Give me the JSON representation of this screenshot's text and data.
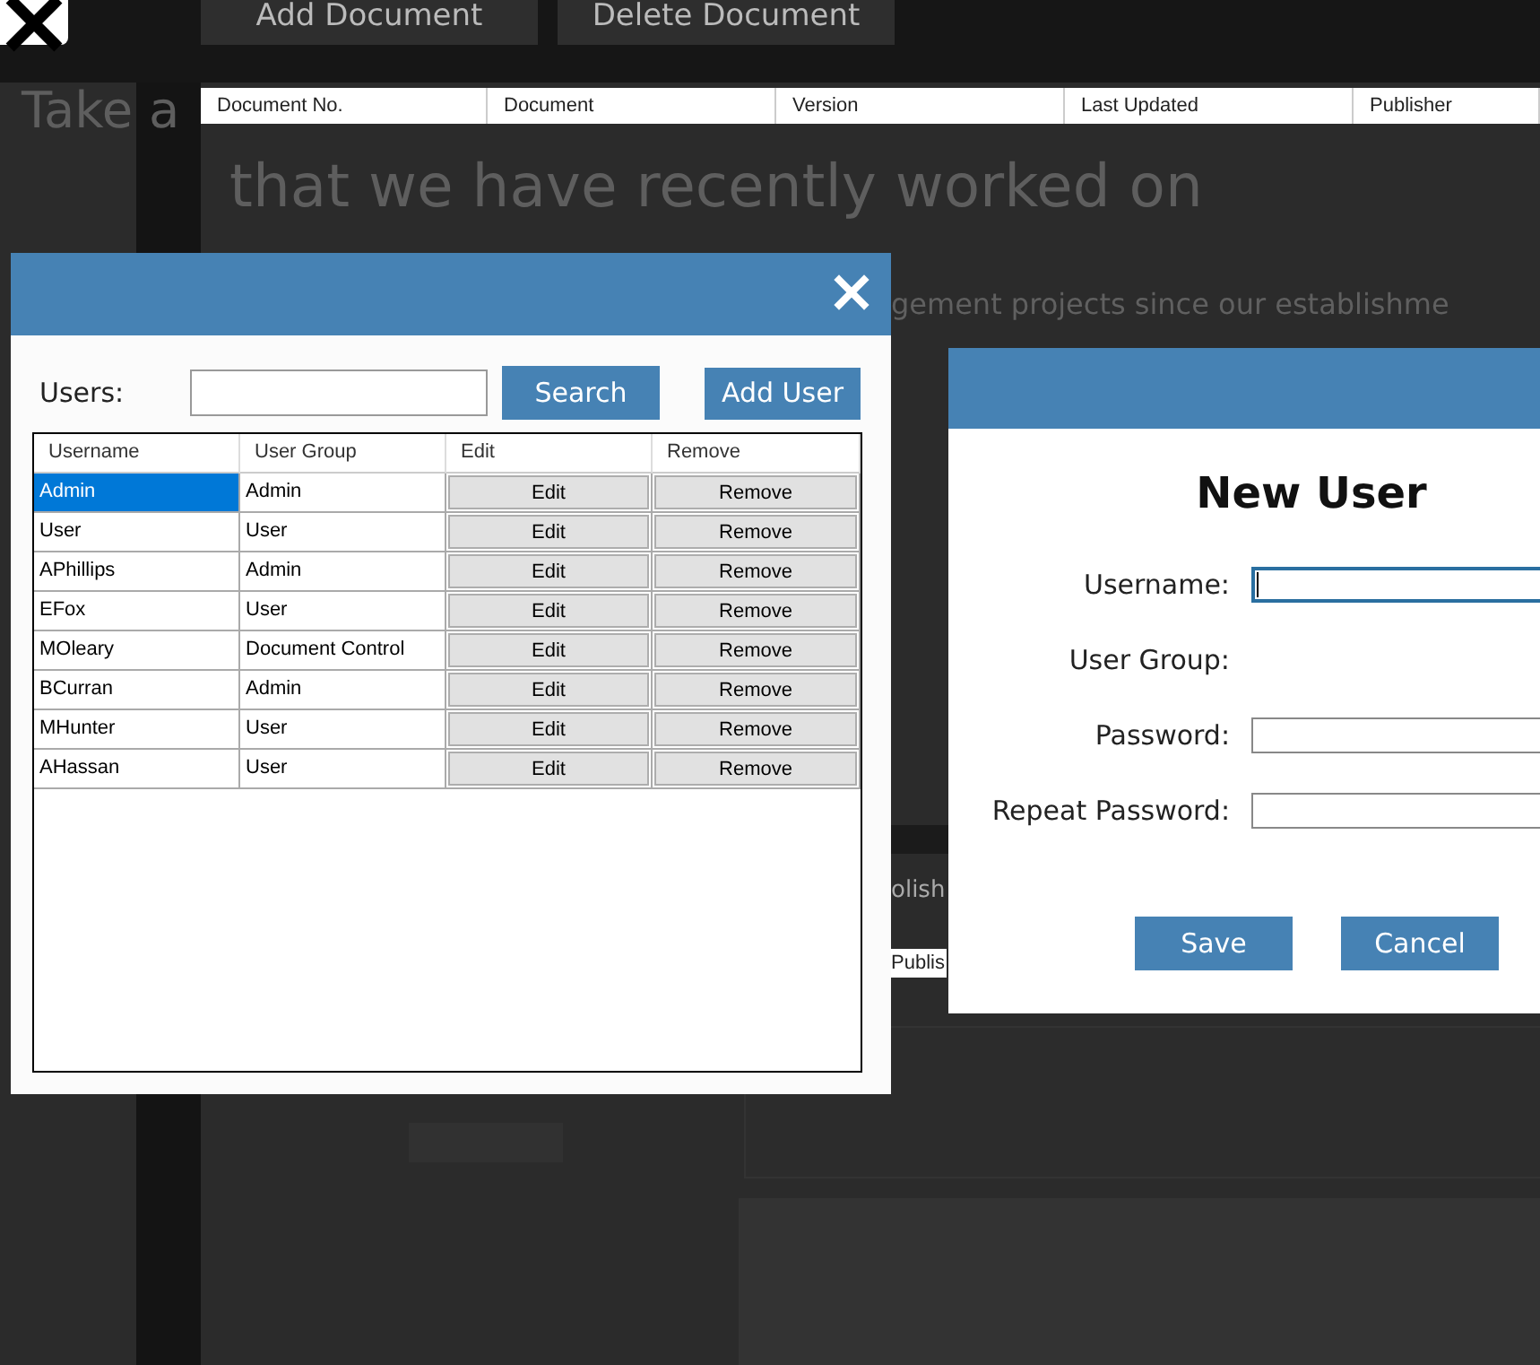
{
  "toolbar": {
    "buttons": [
      "Add Document",
      "Delete Document"
    ]
  },
  "document_table": {
    "columns": [
      "Document No.",
      "Document",
      "Version",
      "Last Updated",
      "Publisher"
    ]
  },
  "background_text": {
    "heading_fragment": "Take a",
    "heading_line_2": "that we have recently worked on",
    "intro_fragment": "gement projects since our establishme",
    "publish_label_fragment": "olish",
    "publish_button_fragment": "Publis"
  },
  "users_dialog": {
    "search_label": "Users:",
    "search_button": "Search",
    "add_button": "Add User",
    "table": {
      "columns": [
        "Username",
        "User Group",
        "Edit",
        "Remove"
      ],
      "rows": [
        {
          "username": "Admin",
          "user_group": "Admin",
          "edit": "Edit",
          "remove": "Remove",
          "selected": true
        },
        {
          "username": "User",
          "user_group": "User",
          "edit": "Edit",
          "remove": "Remove",
          "selected": false
        },
        {
          "username": "APhillips",
          "user_group": "Admin",
          "edit": "Edit",
          "remove": "Remove",
          "selected": false
        },
        {
          "username": "EFox",
          "user_group": "User",
          "edit": "Edit",
          "remove": "Remove",
          "selected": false
        },
        {
          "username": "MOleary",
          "user_group": "Document Control",
          "edit": "Edit",
          "remove": "Remove",
          "selected": false
        },
        {
          "username": "BCurran",
          "user_group": "Admin",
          "edit": "Edit",
          "remove": "Remove",
          "selected": false
        },
        {
          "username": "MHunter",
          "user_group": "User",
          "edit": "Edit",
          "remove": "Remove",
          "selected": false
        },
        {
          "username": "AHassan",
          "user_group": "User",
          "edit": "Edit",
          "remove": "Remove",
          "selected": false
        }
      ]
    }
  },
  "new_user_dialog": {
    "title": "New User",
    "fields": [
      {
        "label": "Username:",
        "kind": "text",
        "focused": true
      },
      {
        "label": "User Group:",
        "kind": "none"
      },
      {
        "label": "Password:",
        "kind": "text",
        "focused": false
      },
      {
        "label": "Repeat Password:",
        "kind": "text",
        "focused": false
      }
    ],
    "buttons": [
      "Save",
      "Cancel"
    ]
  }
}
